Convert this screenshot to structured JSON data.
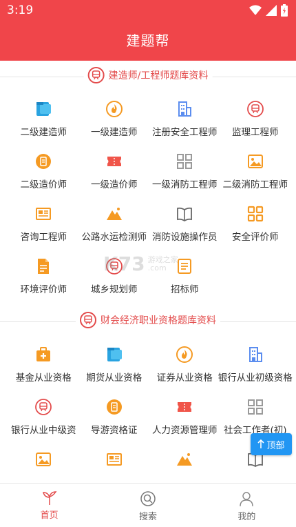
{
  "status": {
    "time": "3:19"
  },
  "header": {
    "title": "建题帮"
  },
  "watermark": {
    "brand": "K73",
    "text1": "游戏之家",
    "text2": ".com"
  },
  "section1": {
    "title": "建造师/工程师题库资料",
    "items": [
      {
        "label": "二级建造师",
        "icon": "document-icon"
      },
      {
        "label": "一级建造师",
        "icon": "fire-icon"
      },
      {
        "label": "注册安全工程师",
        "icon": "building-icon"
      },
      {
        "label": "监理工程师",
        "icon": "train-icon"
      },
      {
        "label": "二级造价师",
        "icon": "certificate-icon"
      },
      {
        "label": "一级造价师",
        "icon": "ticket-icon"
      },
      {
        "label": "一级消防工程师",
        "icon": "grid-icon"
      },
      {
        "label": "二级消防工程师",
        "icon": "image-icon"
      },
      {
        "label": "咨询工程师",
        "icon": "newspaper-icon"
      },
      {
        "label": "公路水运检测师",
        "icon": "mountain-icon"
      },
      {
        "label": "消防设施操作员",
        "icon": "book-icon"
      },
      {
        "label": "安全评价师",
        "icon": "apps-icon"
      },
      {
        "label": "环境评价师",
        "icon": "file-icon"
      },
      {
        "label": "城乡规划师",
        "icon": "train-icon"
      },
      {
        "label": "招标师",
        "icon": "list-icon"
      }
    ]
  },
  "section2": {
    "title": "财会经济职业资格题库资料",
    "items": [
      {
        "label": "基金从业资格",
        "icon": "medkit-icon"
      },
      {
        "label": "期货从业资格",
        "icon": "document-icon"
      },
      {
        "label": "证券从业资格",
        "icon": "fire-icon"
      },
      {
        "label": "银行从业初级资格",
        "icon": "building-icon"
      },
      {
        "label": "银行从业中级资",
        "icon": "train-icon"
      },
      {
        "label": "导游资格证",
        "icon": "certificate-icon"
      },
      {
        "label": "人力资源管理师",
        "icon": "ticket-icon"
      },
      {
        "label": "社会工作者(初)",
        "icon": "grid-icon"
      },
      {
        "label": "",
        "icon": "image-icon"
      },
      {
        "label": "",
        "icon": "newspaper-icon"
      },
      {
        "label": "",
        "icon": "mountain-icon"
      },
      {
        "label": "",
        "icon": "book-icon"
      }
    ]
  },
  "back_to_top": {
    "label": "顶部"
  },
  "tabbar": {
    "tabs": [
      {
        "label": "首页",
        "icon": "sprout-icon",
        "active": true
      },
      {
        "label": "搜索",
        "icon": "search-icon",
        "active": false
      },
      {
        "label": "我的",
        "icon": "user-icon",
        "active": false
      }
    ]
  },
  "colors": {
    "brand": "#f0454a",
    "accent_orange": "#f59a23",
    "accent_blue": "#29a3e0",
    "tab_active": "#e34b4b",
    "top_button": "#2196f3"
  }
}
